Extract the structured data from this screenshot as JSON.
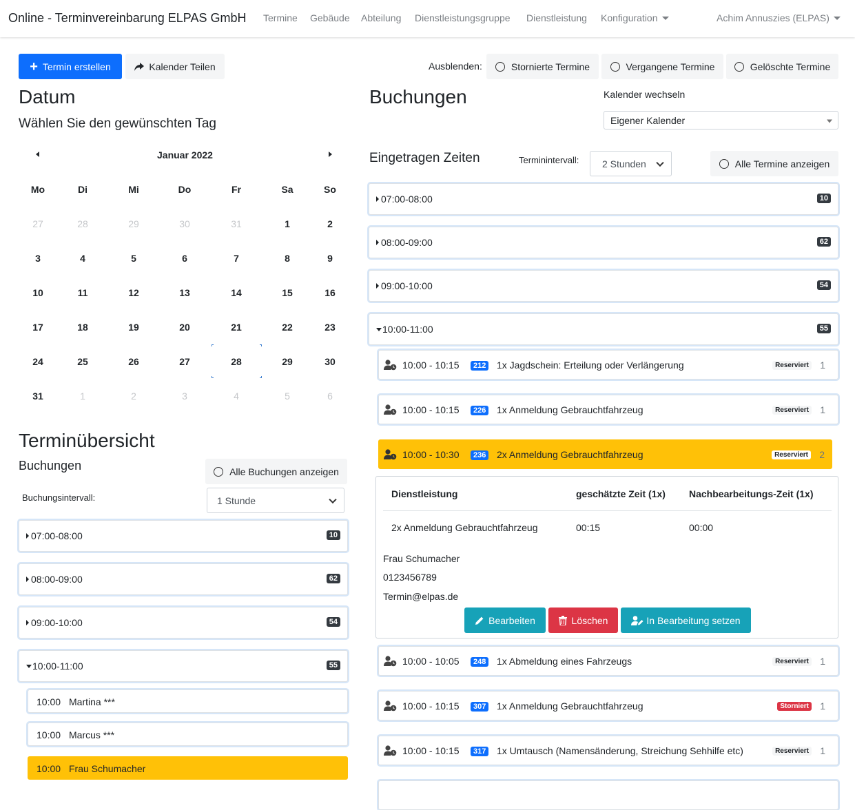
{
  "navbar": {
    "brand": "Online - Terminvereinbarung ELPAS GmbH",
    "links": [
      "Termine",
      "Gebäude",
      "Abteilung",
      "Dienstleistungsgruppe",
      "Dienstleistung"
    ],
    "config_label": "Konfiguration",
    "user_label": "Achim Annuszies (ELPAS)"
  },
  "toolbar": {
    "create_label": "Termin erstellen",
    "share_label": "Kalender Teilen",
    "hide_label": "Ausblenden:",
    "hide_options": [
      "Stornierte Termine",
      "Vergangene Termine",
      "Gelöschte Termine"
    ]
  },
  "datum": {
    "title": "Datum",
    "subtitle": "Wählen Sie den gewünschten Tag",
    "month": "Januar 2022",
    "weekdays": [
      "Mo",
      "Di",
      "Mi",
      "Do",
      "Fr",
      "Sa",
      "So"
    ],
    "weeks": [
      [
        "27",
        "28",
        "29",
        "30",
        "31",
        "1",
        "2"
      ],
      [
        "3",
        "4",
        "5",
        "6",
        "7",
        "8",
        "9"
      ],
      [
        "10",
        "11",
        "12",
        "13",
        "14",
        "15",
        "16"
      ],
      [
        "17",
        "18",
        "19",
        "20",
        "21",
        "22",
        "23"
      ],
      [
        "24",
        "25",
        "26",
        "27",
        "28",
        "29",
        "30"
      ],
      [
        "31",
        "1",
        "2",
        "3",
        "4",
        "5",
        "6"
      ]
    ],
    "selected_day": "28"
  },
  "overview": {
    "title": "Terminübersicht",
    "subtitle": "Buchungen",
    "show_all_label": "Alle Buchungen anzeigen",
    "interval_label": "Buchungsintervall:",
    "interval_value": "1 Stunde",
    "intervals": [
      {
        "label": "07:00-08:00",
        "count": "10"
      },
      {
        "label": "08:00-09:00",
        "count": "62"
      },
      {
        "label": "09:00-10:00",
        "count": "54"
      },
      {
        "label": "10:00-11:00",
        "count": "55"
      }
    ],
    "bookings": [
      {
        "time": "10:00",
        "name": "Martina ***"
      },
      {
        "time": "10:00",
        "name": "Marcus ***"
      },
      {
        "time": "10:00",
        "name": "Frau Schumacher"
      }
    ]
  },
  "buchungen": {
    "title": "Buchungen",
    "calendar_switch_label": "Kalender wechseln",
    "calendar_value": "Eigener Kalender",
    "times_title": "Eingetragen Zeiten",
    "interval_label": "Terminintervall:",
    "interval_value": "2 Stunden",
    "show_all_label": "Alle Termine anzeigen",
    "intervals": [
      {
        "label": "07:00-08:00",
        "count": "10"
      },
      {
        "label": "08:00-09:00",
        "count": "62"
      },
      {
        "label": "09:00-10:00",
        "count": "54"
      },
      {
        "label": "10:00-11:00",
        "count": "55"
      }
    ],
    "appointments": [
      {
        "time": "10:00 - 10:15",
        "num": "212",
        "desc": "1x Jagdschein: Erteilung oder Verlängerung",
        "status": "Reserviert",
        "count": "1"
      },
      {
        "time": "10:00 - 10:15",
        "num": "226",
        "desc": "1x Anmeldung Gebrauchtfahrzeug",
        "status": "Reserviert",
        "count": "1"
      },
      {
        "time": "10:00 - 10:30",
        "num": "236",
        "desc": "2x Anmeldung Gebrauchtfahrzeug",
        "status": "Reserviert",
        "count": "2"
      },
      {
        "time": "10:00 - 10:05",
        "num": "248",
        "desc": "1x Abmeldung eines Fahrzeugs",
        "status": "Reserviert",
        "count": "1"
      },
      {
        "time": "10:00 - 10:15",
        "num": "307",
        "desc": "1x Anmeldung Gebrauchtfahrzeug",
        "status": "Storniert",
        "count": "1"
      },
      {
        "time": "10:00 - 10:15",
        "num": "317",
        "desc": "1x Umtausch (Namensänderung, Streichung Sehhilfe etc)",
        "status": "Reserviert",
        "count": "1"
      }
    ],
    "detail": {
      "col_service": "Dienstleistung",
      "col_time": "geschätzte Zeit (1x)",
      "col_post": "Nachbearbeitungs-Zeit (1x)",
      "service": "2x Anmeldung Gebrauchtfahrzeug",
      "time": "00:15",
      "post": "00:00",
      "name": "Frau Schumacher",
      "phone": "0123456789",
      "email": "Termin@elpas.de",
      "edit_label": "Bearbeiten",
      "delete_label": "Löschen",
      "process_label": "In Bearbeitung setzen"
    }
  },
  "colors": {
    "primary": "#0d6efd",
    "selected": "#ffc107",
    "info": "#17a2b8",
    "danger": "#dc3545",
    "badge_dark": "#343a40"
  }
}
